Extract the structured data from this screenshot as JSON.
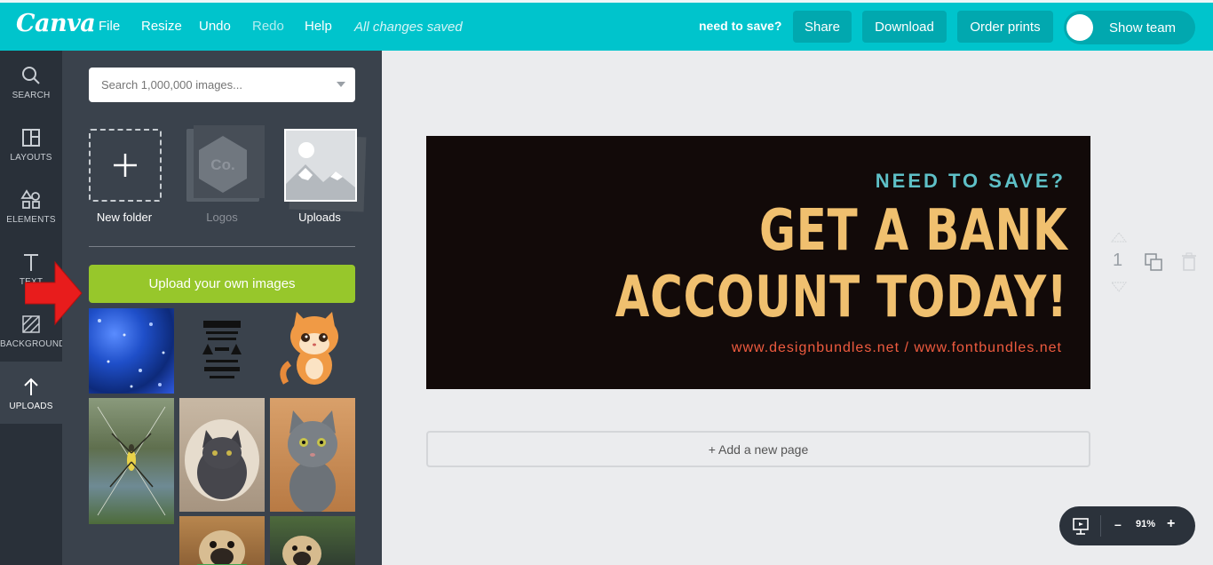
{
  "topbar": {
    "logo": "Canva",
    "menu": [
      "File",
      "Resize",
      "Undo",
      "Redo",
      "Help"
    ],
    "status": "All changes saved",
    "design_title": "need to save?",
    "share": "Share",
    "download": "Download",
    "order_prints": "Order prints",
    "show_team": "Show team"
  },
  "rail": {
    "items": [
      {
        "label": "SEARCH",
        "icon": "search-icon"
      },
      {
        "label": "LAYOUTS",
        "icon": "layouts-icon"
      },
      {
        "label": "ELEMENTS",
        "icon": "elements-icon"
      },
      {
        "label": "TEXT",
        "icon": "text-icon"
      },
      {
        "label": "BACKGROUND",
        "icon": "background-icon"
      },
      {
        "label": "UPLOADS",
        "icon": "upload-arrow-icon"
      }
    ]
  },
  "panel": {
    "search_placeholder": "Search 1,000,000 images...",
    "folders": [
      {
        "label": "New folder"
      },
      {
        "label": "Logos",
        "badge": "Co."
      },
      {
        "label": "Uploads"
      }
    ],
    "upload_button": "Upload your own images"
  },
  "canvas": {
    "line1": "NEED TO SAVE?",
    "line2": "GET A BANK",
    "line3": "ACCOUNT TODAY!",
    "url": "www.designbundles.net / www.fontbundles.net",
    "page_number": "1",
    "add_page": "+ Add a new page"
  },
  "zoom": {
    "level": "91%",
    "minus": "–",
    "plus": "+"
  },
  "colors": {
    "brand": "#00c4cc",
    "upload_green": "#97c72b",
    "canvas_bg": "#120a09",
    "headline": "#f0c06f",
    "accent_teal": "#5ec0c7",
    "url_red": "#ef5b3f"
  }
}
